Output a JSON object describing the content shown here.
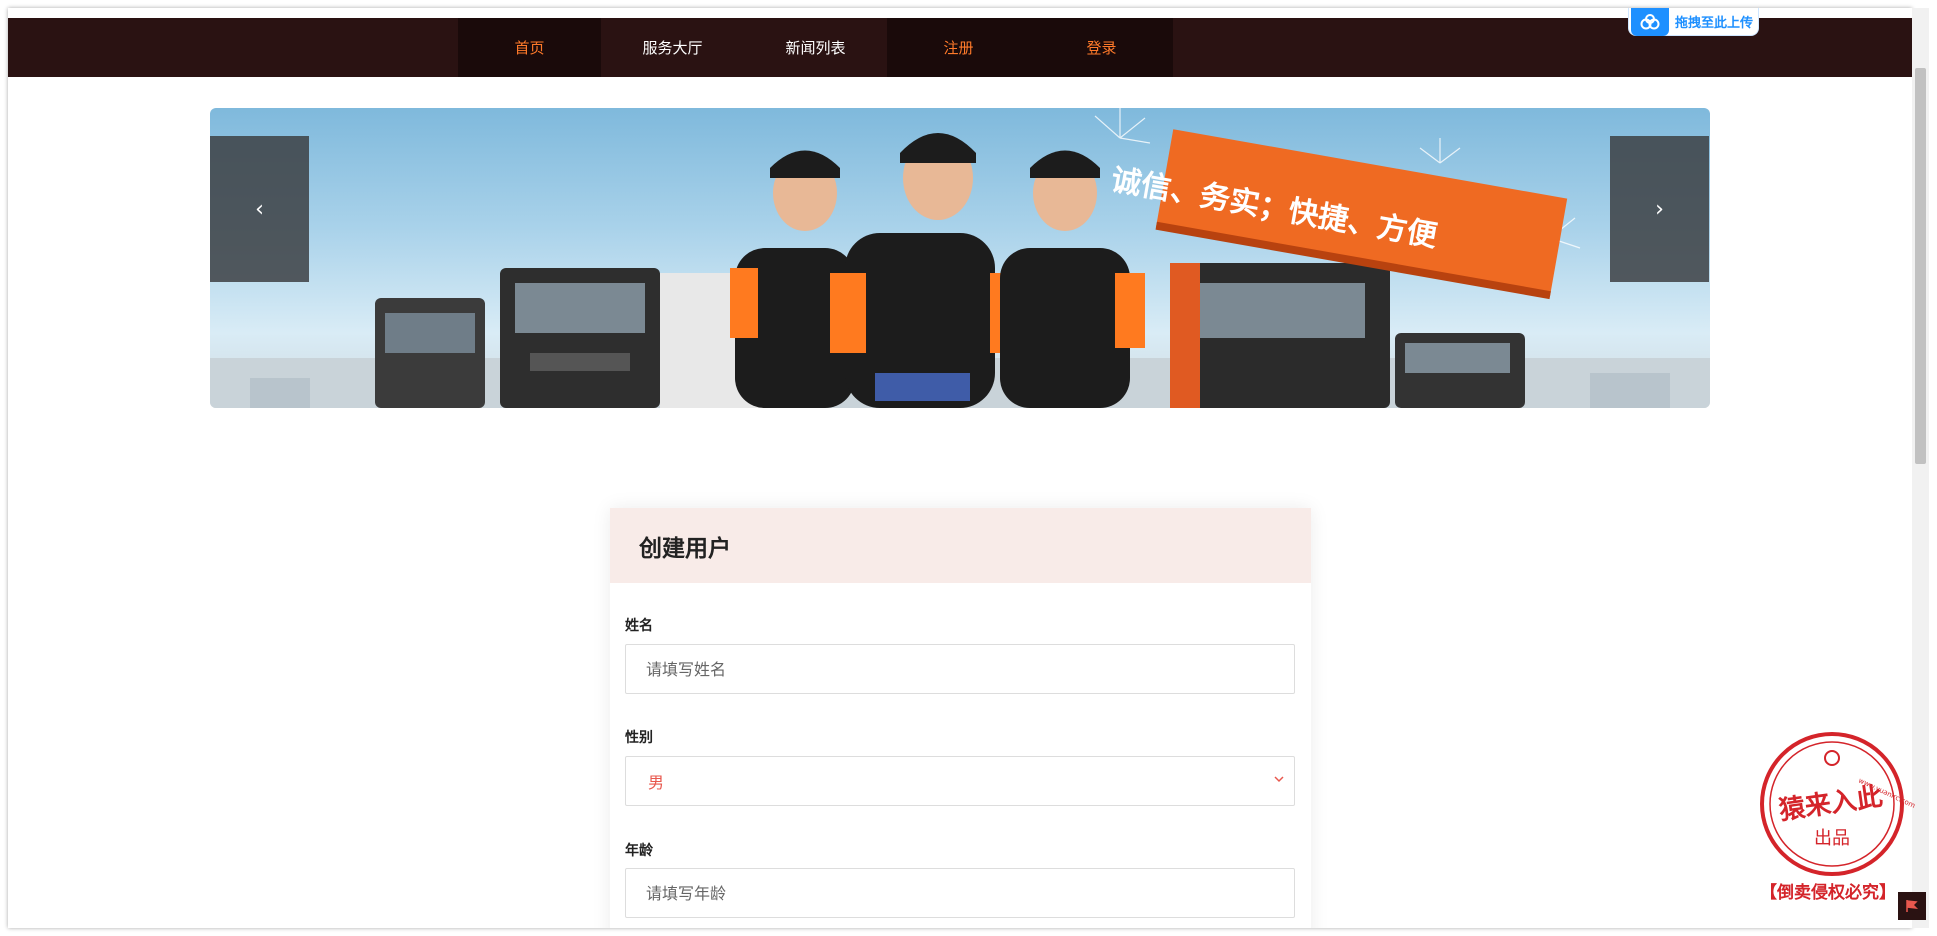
{
  "nav": {
    "items": [
      {
        "label": "首页",
        "style": "orange",
        "dark": true
      },
      {
        "label": "服务大厅",
        "style": "white",
        "dark": false
      },
      {
        "label": "新闻列表",
        "style": "white",
        "dark": false
      },
      {
        "label": "注册",
        "style": "orange",
        "dark": true
      },
      {
        "label": "登录",
        "style": "orange",
        "dark": true
      }
    ]
  },
  "upload_widget": {
    "label": "拖拽至此上传",
    "icon": "cloud-icon"
  },
  "banner": {
    "slogan": "诚信、务实；快捷、方便",
    "prev_icon": "‹",
    "next_icon": "›"
  },
  "form": {
    "title": "创建用户",
    "fields": {
      "name": {
        "label": "姓名",
        "placeholder": "请填写姓名"
      },
      "gender": {
        "label": "性别",
        "value": "男"
      },
      "age": {
        "label": "年龄",
        "placeholder": "请填写年龄"
      }
    }
  },
  "watermark": {
    "url": "www.yuanlrc.com",
    "main": "猿来入此",
    "sub": "出品",
    "notice": "【倒卖侵权必究】"
  },
  "colors": {
    "nav_bg": "#2a1212",
    "nav_active": "#ff7a2a",
    "header_bg": "#f8ebe8",
    "select_text": "#e8584e",
    "seal_red": "#d4242a",
    "upload_blue": "#1e90ff"
  }
}
